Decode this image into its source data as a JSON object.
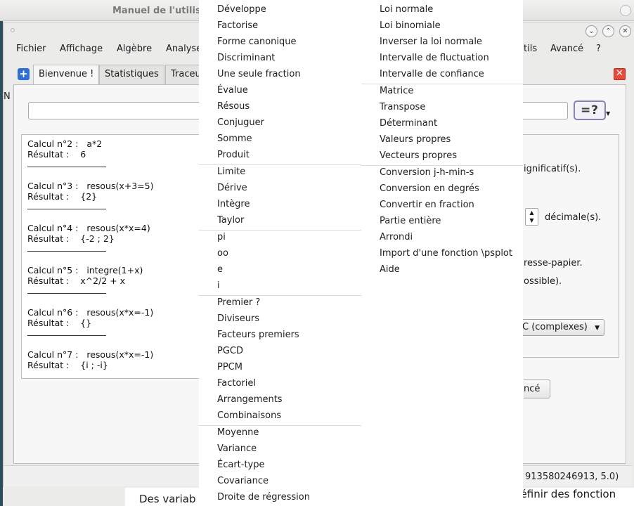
{
  "background_window": {
    "title": "Manuel de l'utilis",
    "bottom_text_left": "Des variab",
    "bottom_text_right": "définir des fonction"
  },
  "window": {
    "minimize_icon": "chevron-down",
    "maximize_icon": "chevron-up",
    "close_icon": "close"
  },
  "menubar": {
    "items": [
      "Fichier",
      "Affichage",
      "Algèbre",
      "Analyse",
      "tils",
      "Avancé",
      "?"
    ]
  },
  "tabs": {
    "add_label": "+",
    "items": [
      "Bienvenue !",
      "Statistiques",
      "Traceu"
    ],
    "close_label": "✕"
  },
  "input": {
    "value": "",
    "eval_label": "=?"
  },
  "history": [
    {
      "calc": "Calcul n°2 :   a*2",
      "result": "Résultat :    6"
    },
    {
      "calc": "Calcul n°3 :   resous(x+3=5)",
      "result": "Résultat :    {2}"
    },
    {
      "calc": "Calcul n°4 :   resous(x*x=4)",
      "result": "Résultat :    {-2 ; 2}"
    },
    {
      "calc": "Calcul n°5 :   integre(1+x)",
      "result": "Résultat :    x^2/2 + x"
    },
    {
      "calc": "Calcul n°6 :   resous(x*x=-1)",
      "result": "Résultat :    {}"
    },
    {
      "calc": "Calcul n°7 :   resous(x*x=-1)",
      "result": "Résultat :    {i ; -i}"
    }
  ],
  "settings": {
    "significant_text": "ignificatif(s).",
    "decimal_text": "décimale(s).",
    "clipboard_text": "resse-papier.",
    "possible_text": "ossible).",
    "mode_value": "C (complexes)",
    "advanced_label": "ncé"
  },
  "status": {
    "text": "913580246913, 5.0)"
  },
  "left_edge_text": "N",
  "dropdown": {
    "left": [
      [
        "Développe",
        "Factorise",
        "Forme canonique",
        "Discriminant",
        "Une seule fraction",
        "Évalue",
        "Résous",
        "Conjuguer",
        "Somme",
        "Produit"
      ],
      [
        "Limite",
        "Dérive",
        "Intègre",
        "Taylor"
      ],
      [
        "pi",
        "oo",
        "e",
        "i"
      ],
      [
        "Premier ?",
        "Diviseurs",
        "Facteurs premiers",
        "PGCD",
        "PPCM",
        "Factoriel",
        "Arrangements",
        "Combinaisons"
      ],
      [
        "Moyenne",
        "Variance",
        "Écart-type",
        "Covariance",
        "Droite de régression"
      ]
    ],
    "right": [
      [
        "Loi normale",
        "Loi binomiale",
        "Inverser la loi normale",
        "Intervalle de fluctuation",
        "Intervalle de confiance"
      ],
      [
        "Matrice",
        "Transpose",
        "Déterminant",
        "Valeurs propres",
        "Vecteurs propres"
      ],
      [
        "Conversion j-h-min-s",
        "Conversion en degrés",
        "Convertir en fraction",
        "Partie entière",
        "Arrondi",
        "Import d'une fonction \\psplot",
        "Aide"
      ]
    ]
  }
}
